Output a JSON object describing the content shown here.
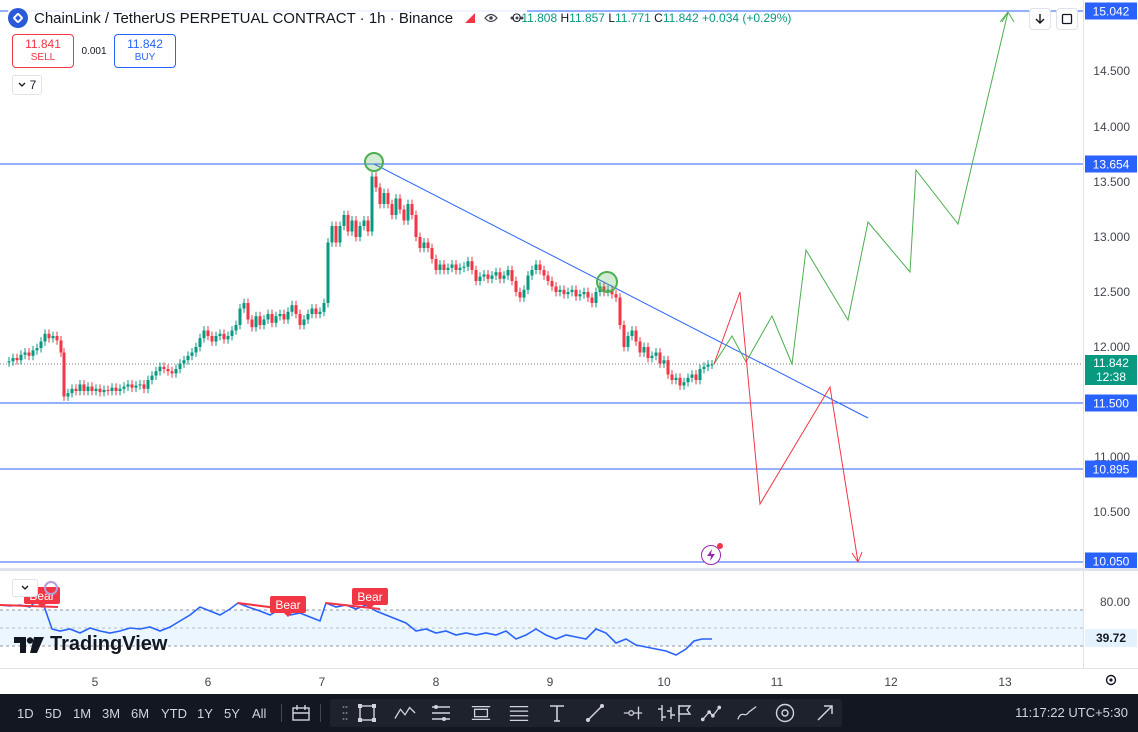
{
  "header": {
    "symbol_title": "ChainLink / TetherUS PERPETUAL CONTRACT · 1h · Binance",
    "ohlc": {
      "o_label": "O",
      "o": "11.808",
      "h_label": "H",
      "h": "11.857",
      "l_label": "L",
      "l": "11.771",
      "c_label": "C",
      "c": "11.842",
      "change": "+0.034 (+0.29%)"
    },
    "download_icon": "arrow-down-icon",
    "fullscreen_icon": "fullscreen-icon"
  },
  "trade": {
    "sell_price": "11.841",
    "sell_label": "SELL",
    "spread": "0.001",
    "buy_price": "11.842",
    "buy_label": "BUY"
  },
  "indicators_collapse": {
    "count": "7"
  },
  "price_scale": {
    "labels": [
      "14.500",
      "14.000",
      "13.500",
      "13.000",
      "12.500",
      "12.000",
      "11.000",
      "10.500"
    ],
    "tags": {
      "top": "15.042",
      "resistance": "13.654",
      "support1": "11.500",
      "support2": "10.895",
      "support3": "10.050"
    },
    "current_price": "11.842",
    "countdown": "12:38"
  },
  "rsi": {
    "level_80": "80.00",
    "value": "39.72",
    "bear_label": "Bear"
  },
  "watermark": {
    "brand": "TradingView"
  },
  "time_scale": {
    "labels": [
      "5",
      "6",
      "7",
      "8",
      "9",
      "10",
      "11",
      "12",
      "13"
    ]
  },
  "bottom_bar": {
    "timeframes": [
      "1D",
      "5D",
      "1M",
      "3M",
      "6M",
      "YTD",
      "1Y",
      "5Y",
      "All"
    ],
    "clock": "11:17:22 UTC+5:30"
  },
  "colors": {
    "up": "#089981",
    "down": "#f23645",
    "line_blue": "#2962ff",
    "projection_green": "#4caf50",
    "projection_red": "#f23645",
    "rsi_line": "#2962ff"
  }
}
